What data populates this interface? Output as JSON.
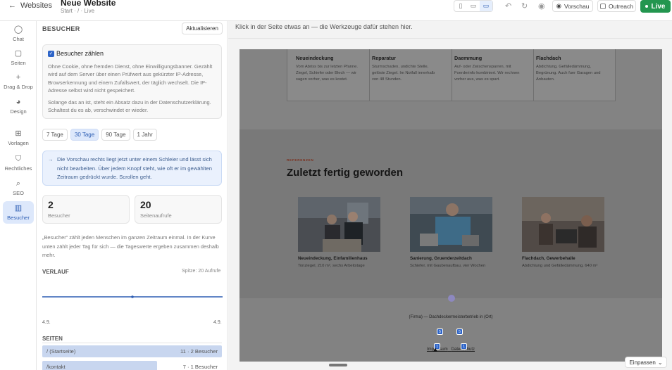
{
  "topbar": {
    "back_label": "Websites",
    "title": "Neue Website",
    "subtitle": "Start · / · Live",
    "preview_label": "Vorschau",
    "outreach_label": "Outreach",
    "live_label": "Live"
  },
  "rail": {
    "items": [
      {
        "label": "Chat",
        "icon": "chat-icon"
      },
      {
        "label": "Seiten",
        "icon": "pages-icon"
      },
      {
        "label": "Drag & Drop",
        "icon": "plus-icon"
      },
      {
        "label": "Design",
        "icon": "palette-icon"
      },
      {
        "label": "Vorlagen",
        "icon": "grid-icon"
      },
      {
        "label": "Rechtliches",
        "icon": "shield-icon"
      },
      {
        "label": "SEO",
        "icon": "search-icon"
      },
      {
        "label": "Besucher",
        "icon": "bar-chart-icon",
        "active": true
      }
    ]
  },
  "panel": {
    "heading": "BESUCHER",
    "refresh_label": "Aktualisieren",
    "toggle_label": "Besucher zählen",
    "toggle_checked": true,
    "toggle_desc_1": "Ohne Cookie, ohne fremden Dienst, ohne Einwilligungsbanner. Gezählt wird auf dem Server über einen Prüfwert aus gekürzter IP-Adresse, Browserkennung und einem Zufallswert, der täglich wechselt. Die IP-Adresse selbst wird nicht gespeichert.",
    "toggle_desc_2": "Solange das an ist, steht ein Absatz dazu in der Datenschutzerklärung. Schaltest du es ab, verschwindet er wieder.",
    "ranges": [
      "7 Tage",
      "30 Tage",
      "90 Tage",
      "1 Jahr"
    ],
    "active_range": "30 Tage",
    "info": "Die Vorschau rechts liegt jetzt unter einem Schleier und lässt sich nicht bearbeiten. Über jedem Knopf steht, wie oft er im gewählten Zeitraum gedrückt wurde. Scrollen geht.",
    "stats": [
      {
        "value": "2",
        "label": "Besucher"
      },
      {
        "value": "20",
        "label": "Seitenaufrufe"
      }
    ],
    "note": "„Besucher“ zählt jeden Menschen im ganzen Zeitraum einmal. In der Kurve unten zählt jeder Tag für sich — die Tageswerte ergeben zusammen deshalb mehr.",
    "trend_heading": "VERLAUF",
    "trend_peak": "Spitze: 20 Aufrufe",
    "trend_x_start": "4.9.",
    "trend_x_end": "4.9.",
    "trend_peak_value": 20,
    "pages_heading": "SEITEN",
    "pages": [
      {
        "path": "/ (Startseite)",
        "count": "11 · 2 Besucher",
        "share": 1.0
      },
      {
        "path": "/kontakt",
        "count": "7 · 1 Besucher",
        "share": 0.64
      }
    ]
  },
  "main": {
    "hint": "Klick in der Seite etwas an — die Werkzeuge dafür stehen hier.",
    "fit_label": "Einpassen"
  },
  "preview": {
    "services": [
      {
        "title": "Neueindeckung",
        "text": "Vom Abriss bis zur letzten Pfanne. Ziegel, Schiefer oder Blech — wir sagen vorher, was es kostet."
      },
      {
        "title": "Reparatur",
        "text": "Sturmschaden, undichte Stelle, gelöste Ziegel. Im Notfall innerhalb von 48 Stunden."
      },
      {
        "title": "Daemmung",
        "text": "Auf- oder Zwischensparren, mit Foerderinfo kombiniert. Wir rechnen vorher aus, was es spart."
      },
      {
        "title": "Flachdach",
        "text": "Abdichtung, Gefälledämmung, Begrünung. Auch fuer Garagen und Anbauten."
      }
    ],
    "kicker": "REFERENZEN",
    "heading": "Zuletzt fertig geworden",
    "references": [
      {
        "title": "Neueindeckung, Einfamilienhaus",
        "meta": "Tonziegel, 210 m², sechs Arbeitstage"
      },
      {
        "title": "Sanierung, Gruenderzeitdach",
        "meta": "Schiefer, mit Gaubenaufbau, vier Wochen"
      },
      {
        "title": "Flachdach, Gewerbehalle",
        "meta": "Abdichtung und Gefälledämmung, 640 m²"
      }
    ],
    "footer_text": "(Firma) — Dachdeckermeisterbetrieb in (Ort)",
    "footer_links": [
      "Impressum",
      "Datenschutz"
    ],
    "footer_badges": [
      "5",
      "5",
      "1",
      "1"
    ]
  }
}
